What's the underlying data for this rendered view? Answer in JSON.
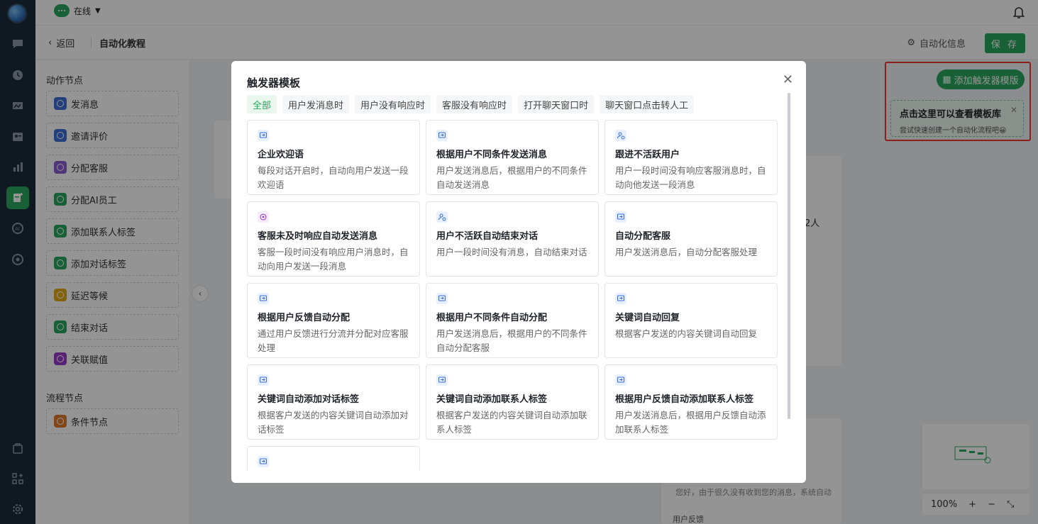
{
  "topbar": {
    "status_label": "在线"
  },
  "header": {
    "back_label": "返回",
    "title": "自动化教程",
    "auto_info_label": "自动化信息",
    "save_label": "保 存"
  },
  "sidebar": {
    "action_section": "动作节点",
    "action_nodes": [
      {
        "label": "发消息",
        "color": "#3b6fd6"
      },
      {
        "label": "邀请评价",
        "color": "#3b6fd6"
      },
      {
        "label": "分配客服",
        "color": "#8a5cd1"
      },
      {
        "label": "分配AI员工",
        "color": "#2aa65c"
      },
      {
        "label": "添加联系人标签",
        "color": "#2aa65c"
      },
      {
        "label": "添加对话标签",
        "color": "#2aa65c"
      },
      {
        "label": "延迟等候",
        "color": "#e6a817"
      },
      {
        "label": "结束对话",
        "color": "#2aa65c"
      },
      {
        "label": "关联赋值",
        "color": "#9b3cc8"
      }
    ],
    "flow_section": "流程节点",
    "flow_nodes": [
      {
        "label": "条件节点",
        "color": "#e07a2a"
      }
    ]
  },
  "canvas": {
    "add_template_label": "添加触发器模版",
    "tip_title": "点击这里可以查看模板库",
    "tip_sub": "尝试快速创建一个自动化流程吧😀",
    "zoom": "100%",
    "edge_text": "2人",
    "preview_text": "您好，由于很久没有收到您的消息，系统自动",
    "feedback_label": "用户反馈"
  },
  "modal": {
    "title": "触发器模板",
    "tabs": [
      "全部",
      "用户发消息时",
      "用户没有响应时",
      "客服没有响应时",
      "打开聊天窗口时",
      "聊天窗口点击转人工"
    ],
    "cards": [
      {
        "title": "企业欢迎语",
        "desc": "每段对话开启时，自动向用户发送一段欢迎语",
        "icon": "message-icon"
      },
      {
        "title": "根据用户不同条件发送消息",
        "desc": "用户发送消息后，根据用户的不同条件自动发送消息",
        "icon": "message-icon"
      },
      {
        "title": "跟进不活跃用户",
        "desc": "用户一段时间没有响应客服消息时，自动向他发送一段消息",
        "icon": "user-clock-icon"
      },
      {
        "title": "客服未及时响应自动发送消息",
        "desc": "客服一段时间没有响应用户消息时，自动向用户发送一段消息",
        "icon": "agent-icon"
      },
      {
        "title": "用户不活跃自动结束对话",
        "desc": "用户一段时间没有消息，自动结束对话",
        "icon": "user-clock-icon"
      },
      {
        "title": "自动分配客服",
        "desc": "用户发送消息后，自动分配客服处理",
        "icon": "message-icon"
      },
      {
        "title": "根据用户反馈自动分配",
        "desc": "通过用户反馈进行分流并分配对应客服处理",
        "icon": "message-icon"
      },
      {
        "title": "根据用户不同条件自动分配",
        "desc": "用户发送消息后，根据用户的不同条件自动分配客服",
        "icon": "message-icon"
      },
      {
        "title": "关键词自动回复",
        "desc": "根据客户发送的内容关键词自动回复",
        "icon": "message-icon"
      },
      {
        "title": "关键词自动添加对话标签",
        "desc": "根据客户发送的内容关键词自动添加对话标签",
        "icon": "message-icon"
      },
      {
        "title": "关键词自动添加联系人标签",
        "desc": "根据客户发送的内容关键词自动添加联系人标签",
        "icon": "message-icon"
      },
      {
        "title": "根据用户反馈自动添加联系人标签",
        "desc": "用户发送消息后，根据用户反馈自动添加联系人标签",
        "icon": "message-icon"
      },
      {
        "title": "",
        "desc": "",
        "icon": "message-icon"
      }
    ]
  }
}
